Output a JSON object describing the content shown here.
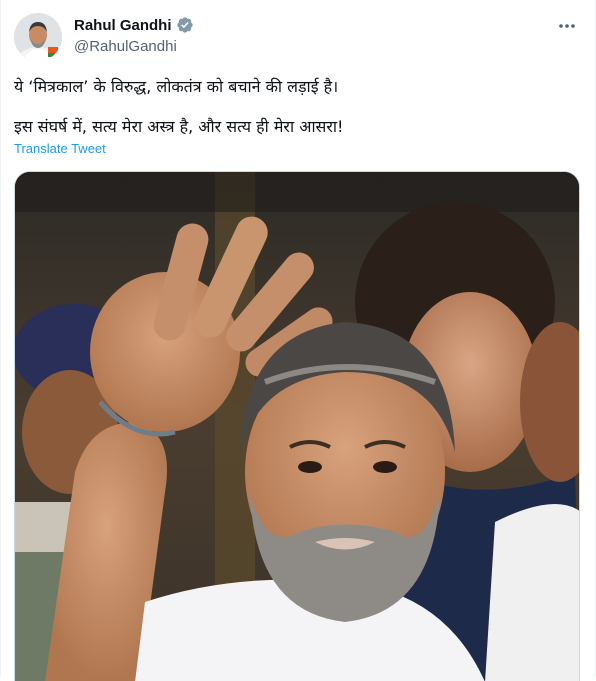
{
  "tweet": {
    "author": {
      "display_name": "Rahul Gandhi",
      "handle": "@RahulGandhi",
      "verified": true
    },
    "text_line_1": "ये ‘मित्रकाल’ के विरुद्ध, लोकतंत्र को बचाने की लड़ाई है।",
    "text_line_2": "इस संघर्ष में, सत्य मेरा अस्त्र है, और सत्य ही मेरा आसरा!",
    "translate_label": "Translate Tweet",
    "icons": {
      "verified": "verified-badge-icon",
      "more": "more-options-icon"
    }
  },
  "colors": {
    "link": "#1d9bf0",
    "secondary_text": "#536471",
    "primary_text": "#0f1419",
    "verified_badge": "#829aab"
  }
}
